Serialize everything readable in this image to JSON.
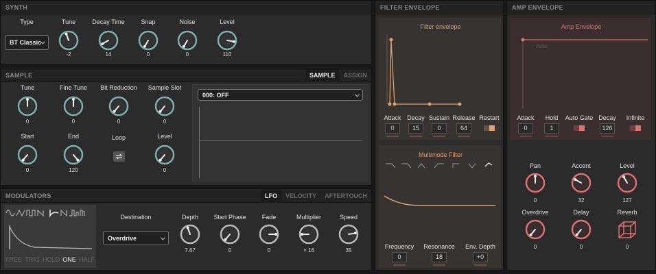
{
  "synth": {
    "title": "SYNTH",
    "type_label": "Type",
    "type_value": "BT Classic",
    "knobs": [
      {
        "label": "Tune",
        "value": "-2"
      },
      {
        "label": "Decay Time",
        "value": "14"
      },
      {
        "label": "Snap",
        "value": "0"
      },
      {
        "label": "Noise",
        "value": "0"
      },
      {
        "label": "Level",
        "value": "110"
      }
    ]
  },
  "sample": {
    "title": "SAMPLE",
    "tabs": [
      "SAMPLE",
      "ASSIGN"
    ],
    "knobs": [
      {
        "label": "Tune",
        "value": "0"
      },
      {
        "label": "Fine Tune",
        "value": "0"
      },
      {
        "label": "Bit Reduction",
        "value": "0"
      },
      {
        "label": "Sample Slot",
        "value": "0"
      },
      {
        "label": "Start",
        "value": "0"
      },
      {
        "label": "End",
        "value": "120"
      },
      {
        "label": "Level",
        "value": "0"
      }
    ],
    "loop_label": "Loop",
    "slot_value": "000: OFF"
  },
  "modulators": {
    "title": "MODULATORS",
    "tabs": [
      "LFO",
      "VELOCITY",
      "AFTERTOUCH"
    ],
    "modes": [
      "FREE",
      "TRIG",
      "HOLD",
      "ONE",
      "HALF"
    ],
    "destination_label": "Destination",
    "destination_value": "Overdrive",
    "knobs": [
      {
        "label": "Depth",
        "value": "7.67"
      },
      {
        "label": "Start Phase",
        "value": "0"
      },
      {
        "label": "Fade",
        "value": "0"
      },
      {
        "label": "Multiplier",
        "value": "× 16"
      },
      {
        "label": "Speed",
        "value": "35"
      }
    ]
  },
  "filter_envelope": {
    "title": "FILTER ENVELOPE",
    "graph_title": "Filter envelope",
    "params": [
      {
        "label": "Attack",
        "value": "0"
      },
      {
        "label": "Decay",
        "value": "15"
      },
      {
        "label": "Sustain",
        "value": "0"
      },
      {
        "label": "Release",
        "value": "64"
      },
      {
        "label": "Restart",
        "value": ""
      }
    ]
  },
  "multimode_filter": {
    "title": "Multimode Filter",
    "params": [
      {
        "label": "Frequency",
        "value": "0"
      },
      {
        "label": "Resonance",
        "value": "18"
      },
      {
        "label": "Env. Depth",
        "value": "+0"
      }
    ]
  },
  "amp_envelope": {
    "title": "AMP ENVELOPE",
    "graph_title": "Amp Envelope",
    "graph_mode": "Auto",
    "params": [
      {
        "label": "Attack",
        "value": "0"
      },
      {
        "label": "Hold",
        "value": "1"
      },
      {
        "label": "Auto Gate",
        "value": ""
      },
      {
        "label": "Decay",
        "value": "126"
      },
      {
        "label": "Infinite",
        "value": ""
      }
    ],
    "knobs": [
      {
        "label": "Pan",
        "value": "0"
      },
      {
        "label": "Accent",
        "value": "32"
      },
      {
        "label": "Level",
        "value": "127"
      },
      {
        "label": "Overdrive",
        "value": "0"
      },
      {
        "label": "Delay",
        "value": "0"
      },
      {
        "label": "Reverb",
        "value": "0"
      }
    ]
  },
  "colors": {
    "filter_accent": "#e0a070",
    "amp_accent": "#e07070",
    "knob_accent": "#8fc0c0"
  }
}
